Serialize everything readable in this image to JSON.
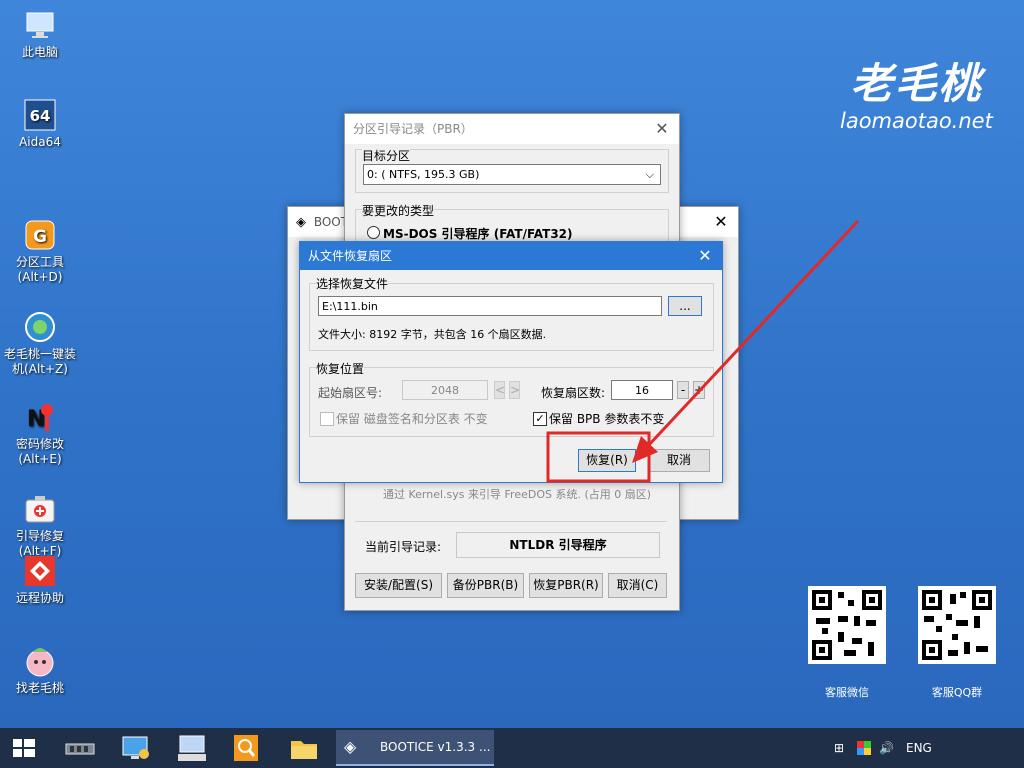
{
  "desktop": {
    "icons": [
      {
        "label": "此电脑",
        "icon": "this-pc-icon"
      },
      {
        "label": "Aida64",
        "icon": "aida64-icon"
      },
      {
        "label": "分区工具\n(Alt+D)",
        "icon": "partition-tool-icon"
      },
      {
        "label": "老毛桃一键装\n机(Alt+Z)",
        "icon": "one-key-install-icon"
      },
      {
        "label": "密码修改\n(Alt+E)",
        "icon": "password-tool-icon"
      },
      {
        "label": "引导修复\n(Alt+F)",
        "icon": "boot-repair-icon"
      },
      {
        "label": "远程协助",
        "icon": "remote-assist-icon"
      },
      {
        "label": "找老毛桃",
        "icon": "laomaotao-icon"
      }
    ],
    "brand_cn": "老毛桃",
    "brand_en": "laomaotao.net",
    "qr_codes": [
      {
        "label": "客服微信"
      },
      {
        "label": "客服QQ群"
      }
    ]
  },
  "bootice_window": {
    "title": "BOOT"
  },
  "pbr_window": {
    "title": "分区引导记录（PBR）",
    "target_label": "目标分区",
    "target_value": "0: ( NTFS, 195.3 GB)",
    "type_label": "要更改的类型",
    "type_option": "MS-DOS 引导程序 (FAT/FAT32)",
    "freedos_hint": "通过 Kernel.sys 来引导 FreeDOS 系统. (占用 0 扇区)",
    "current_label": "当前引导记录:",
    "current_value": "NTLDR 引导程序",
    "buttons": {
      "install": "安装/配置(S)",
      "backup": "备份PBR(B)",
      "restore": "恢复PBR(R)",
      "cancel": "取消(C)"
    }
  },
  "restore_dialog": {
    "title": "从文件恢复扇区",
    "file_group": "选择恢复文件",
    "file_path": "E:\\111.bin",
    "browse": "...",
    "file_info": "文件大小: 8192 字节，共包含 16 个扇区数据.",
    "pos_group": "恢复位置",
    "start_label": "起始扇区号:",
    "start_value": "2048",
    "count_label": "恢复扇区数:",
    "count_value": "16",
    "minus": "-",
    "plus": "+",
    "keep_sig_label": "保留 磁盘签名和分区表 不变",
    "keep_sig_checked": false,
    "keep_bpb_label": "保留 BPB 参数表不变",
    "keep_bpb_checked": true,
    "ok": "恢复(R)",
    "cancel": "取消"
  },
  "annotation": {
    "color": "#e02a2a"
  },
  "taskbar": {
    "app_label": "BOOTICE v1.3.3 ...",
    "lang": "ENG"
  }
}
